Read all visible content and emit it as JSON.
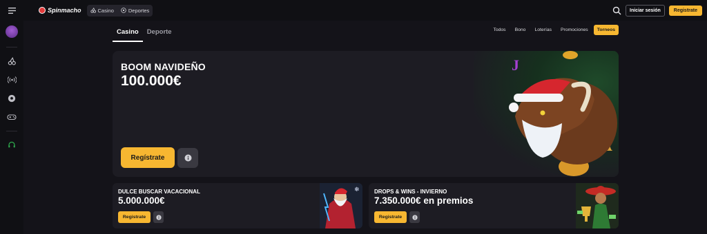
{
  "brand": {
    "name": "Spinmacho"
  },
  "mode_switch": {
    "casino_label": "Casino",
    "sports_label": "Deportes"
  },
  "header": {
    "login_label": "Iniciar sesión",
    "register_label": "Registrate"
  },
  "section_tabs": [
    {
      "label": "Casino",
      "active": true
    },
    {
      "label": "Deporte",
      "active": false
    }
  ],
  "filters": [
    {
      "label": "Todos",
      "active": false
    },
    {
      "label": "Bono",
      "active": false
    },
    {
      "label": "Loterías",
      "active": false
    },
    {
      "label": "Promociones",
      "active": false
    },
    {
      "label": "Torneos",
      "active": true
    }
  ],
  "hero": {
    "title": "BOOM NAVIDEÑO",
    "amount": "100.000€",
    "cta_label": "Regístrate"
  },
  "promo_cards": [
    {
      "title": "DULCE BUSCAR VACACIONAL",
      "amount": "5.000.000€",
      "cta_label": "Registrate"
    },
    {
      "title": "DROPS & WINS - INVIERNO",
      "amount": "7.350.000€ en premios",
      "cta_label": "Registrate"
    }
  ],
  "colors": {
    "accent": "#f7b731",
    "background": "#141319",
    "panel": "#1d1c23",
    "sidebar": "#101014"
  },
  "icons": [
    "hamburger-icon",
    "cherries-icon",
    "soccer-ball-icon",
    "search-icon",
    "broadcast-icon",
    "gamepad-icon",
    "headset-icon",
    "info-icon"
  ]
}
